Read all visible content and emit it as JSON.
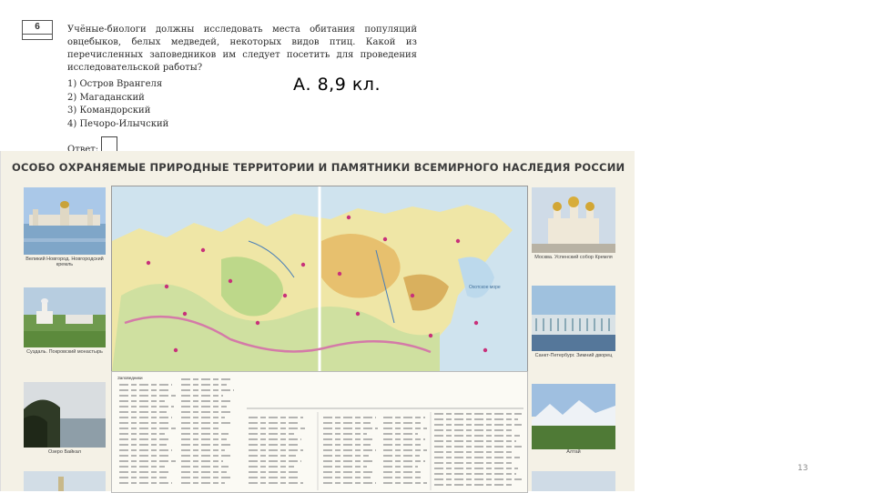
{
  "question": {
    "number": "6",
    "text": "Учёные-биологи должны исследовать места обитания популяций овцебыков, белых медведей, некоторых видов птиц. Какой из перечисленных заповедников им следует посетить для проведения исследовательской работы?",
    "options": [
      "1)  Остров Врангеля",
      "2)  Магаданский",
      "3)  Командорский",
      "4)  Печоро-Илычский"
    ],
    "answer_label": "Ответ:"
  },
  "overlay_text": "А. 8,9 кл.",
  "poster": {
    "title": "ОСОБО ОХРАНЯЕМЫЕ ПРИРОДНЫЕ ТЕРРИТОРИИ И  ПАМЯТНИКИ ВСЕМИРНОГО НАСЛЕДИЯ РОССИИ",
    "left_captions": [
      "Великий Новгород. Новгородский кремль",
      "Суздаль. Покровский монастырь",
      "Озеро Байкал"
    ],
    "right_captions": [
      "Москва. Успенский собор Кремля",
      "Санкт-Петербург. Зимний дворец",
      "Алтай"
    ],
    "map_sea_label": "Охотское море",
    "legend_heading": "Заповедники"
  },
  "page_number": "13"
}
